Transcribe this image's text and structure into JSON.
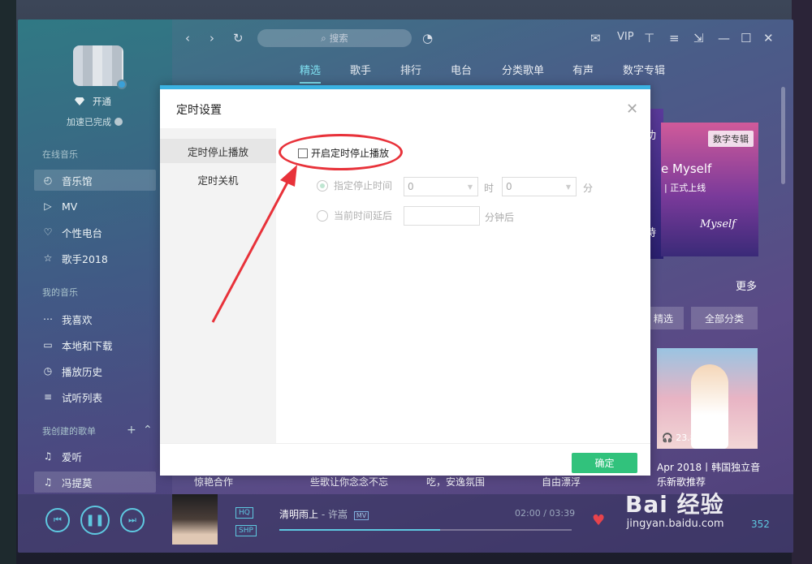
{
  "sidebar": {
    "vip_label": "开通",
    "accel_label": "加速已完成",
    "online_music_title": "在线音乐",
    "online_items": [
      {
        "label": "音乐馆",
        "icon": "music-hall-icon"
      },
      {
        "label": "MV",
        "icon": "mv-icon"
      },
      {
        "label": "个性电台",
        "icon": "radio-heart-icon"
      },
      {
        "label": "歌手2018",
        "icon": "star-icon"
      }
    ],
    "my_music_title": "我的音乐",
    "my_items": [
      {
        "label": "我喜欢",
        "icon": "favorites-icon"
      },
      {
        "label": "本地和下载",
        "icon": "monitor-icon"
      },
      {
        "label": "播放历史",
        "icon": "history-icon"
      },
      {
        "label": "试听列表",
        "icon": "playlist-icon"
      }
    ],
    "created_title": "我创建的歌单",
    "created_items": [
      {
        "label": "爱听",
        "icon": "note-icon"
      },
      {
        "label": "冯提莫",
        "icon": "note-icon"
      }
    ]
  },
  "topbar": {
    "search_placeholder": "搜索",
    "vip_label": "VIP"
  },
  "tabs": [
    "精选",
    "歌手",
    "排行",
    "电台",
    "分类歌单",
    "有声",
    "数字专辑"
  ],
  "content": {
    "album_tag": "数字专辑",
    "album_title": "e Myself",
    "album_sub": "| 正式上线",
    "album_logo": "Myself",
    "side_char": "功",
    "side_char2": "持",
    "more_label": "更多",
    "cat_buttons": [
      "精选",
      "全部分类"
    ],
    "photo_plays": "23.8万",
    "photo_caption": "Apr 2018丨韩国独立音乐新歌推荐",
    "row_captions": [
      "惊艳合作",
      "些歌让你念念不忘",
      "吃，安逸氛围",
      "自由漂浮"
    ]
  },
  "player": {
    "quality_tags": [
      "HQ",
      "SHP"
    ],
    "song_title": "清明雨上",
    "song_artist": "许嵩",
    "mv_tag": "MV",
    "time": "02:00 / 03:39",
    "progress": 0.55,
    "count": "352"
  },
  "modal": {
    "title": "定时设置",
    "tabs": [
      "定时停止播放",
      "定时关机"
    ],
    "enable_label": "开启定时停止播放",
    "option_specify": "指定停止时间",
    "hour_value": "0",
    "hour_unit": "时",
    "minute_value": "0",
    "minute_unit": "分",
    "option_delay": "当前时间延后",
    "delay_unit": "分钟后",
    "ok_label": "确定"
  },
  "watermark": {
    "main": "Bai 经验",
    "sub": "jingyan.baidu.com"
  },
  "colors": {
    "accent": "#5ec8e0",
    "ok_green": "#31c27c",
    "annotation_red": "#e8323a",
    "modal_top": "#3ab2e2"
  }
}
